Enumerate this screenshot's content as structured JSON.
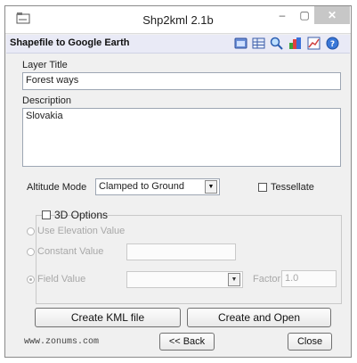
{
  "window": {
    "title": "Shp2kml 2.1b",
    "minimize_glyph": "–",
    "maximize_glyph": "▢",
    "close_glyph": "✕"
  },
  "header": {
    "title": "Shapefile to Google Earth",
    "toolbar_icons": [
      "window-icon",
      "table-icon",
      "zoom-icon",
      "color-icon",
      "chart-icon",
      "help-icon"
    ]
  },
  "layer_title": {
    "label": "Layer Title",
    "value": "Forest ways"
  },
  "description": {
    "label": "Description",
    "value": "Slovakia"
  },
  "altitude": {
    "label": "Altitude Mode",
    "value": "Clamped to Ground",
    "arrow": "▼"
  },
  "tessellate": {
    "label": "Tessellate",
    "checked": false
  },
  "options_3d": {
    "label": "3D Options",
    "checked": false,
    "use_elevation_label": "Use Elevation Value",
    "constant_value_label": "Constant Value",
    "constant_value": "",
    "field_value_label": "Field Value",
    "field_value": "",
    "arrow": "▼",
    "factor_label": "Factor",
    "factor_value": "1.0",
    "selected": "field_value"
  },
  "buttons": {
    "create_kml": "Create KML file",
    "create_open": "Create and Open",
    "back": "<< Back",
    "close": "Close"
  },
  "footer": {
    "website": "www.zonums.com"
  },
  "colors": {
    "header_bg": "#e9eaf6",
    "window_bg": "#f0f0f0",
    "close_btn": "#c7c7c7"
  }
}
